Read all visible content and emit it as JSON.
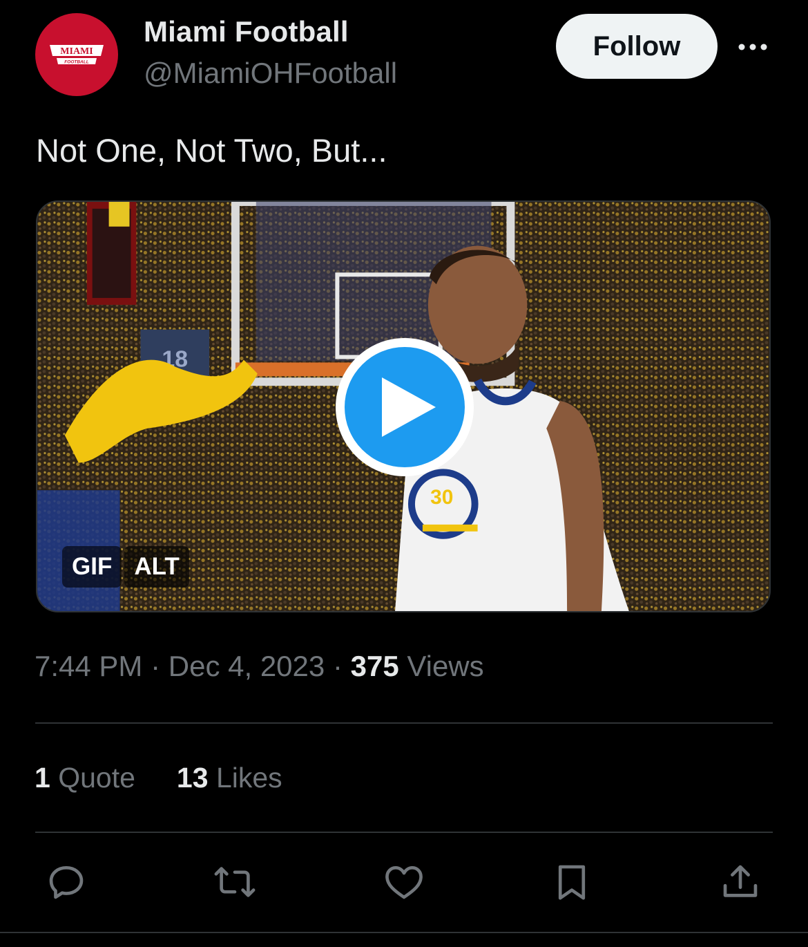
{
  "author": {
    "display_name": "Miami Football",
    "handle": "@MiamiOHFootball",
    "avatar_logo_text": "MIAMI",
    "avatar_logo_subtext": "FOOTBALL",
    "avatar_color": "#c8102e"
  },
  "header": {
    "follow_label": "Follow",
    "more_icon": "more-horizontal-icon"
  },
  "tweet": {
    "text": "Not One, Not Two, But..."
  },
  "media": {
    "type": "gif",
    "badge_gif": "GIF",
    "badge_alt": "ALT",
    "jersey_number": "30",
    "play_icon": "play-icon",
    "accent": "#1d9bf0"
  },
  "meta": {
    "time": "7:44 PM",
    "separator": "·",
    "date": "Dec 4, 2023",
    "views_count": "375",
    "views_label": "Views"
  },
  "stats": {
    "quotes_count": "1",
    "quotes_label": "Quote",
    "likes_count": "13",
    "likes_label": "Likes"
  },
  "actions": [
    "reply-icon",
    "retweet-icon",
    "like-icon",
    "bookmark-icon",
    "share-icon"
  ]
}
